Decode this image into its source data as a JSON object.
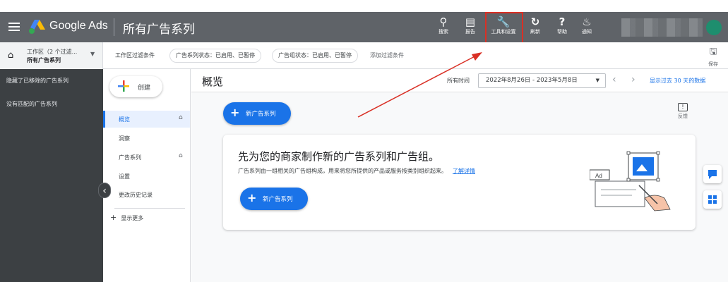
{
  "header": {
    "brand": "Google Ads",
    "page_title": "所有广告系列",
    "tools": [
      {
        "icon": "search-icon",
        "label": "搜索"
      },
      {
        "icon": "reports-icon",
        "label": "报告"
      },
      {
        "icon": "wrench-icon",
        "label": "工具和设置"
      },
      {
        "icon": "refresh-icon",
        "label": "刷新"
      },
      {
        "icon": "help-icon",
        "label": "帮助"
      },
      {
        "icon": "bell-icon",
        "label": "通知"
      }
    ]
  },
  "workspace": {
    "line1": "工作区（2 个过滤...",
    "line2": "所有广告系列"
  },
  "filterbar": {
    "label": "工作区过滤条件",
    "chips": [
      "广告系列状态：已启用、已暂停",
      "广告组状态：已启用、已暂停"
    ],
    "add_filter": "添加过滤条件",
    "save_label": "保存"
  },
  "left_panel": {
    "removed": "隐藏了已移除的广告系列",
    "none": "没有匹配的广告系列"
  },
  "nav": {
    "create_label": "创建",
    "items": [
      {
        "label": "概览",
        "active": true
      },
      {
        "label": "洞察"
      },
      {
        "label": "广告系列"
      },
      {
        "label": "设置"
      },
      {
        "label": "更改历史记录"
      }
    ],
    "show_more": "显示更多"
  },
  "main": {
    "title": "概览",
    "date_label": "所有时间",
    "date_range": "2022年8月26日 - 2023年5月8日",
    "last30": "显示过去 30 天的数据",
    "new_campaign_label": "新广告系列",
    "feedback_label": "反馈",
    "card": {
      "title": "先为您的商家制作新的广告系列和广告组。",
      "desc": "广告系列由一组相关的广告组构成，用来将您所提供的产品或服务按类别组织起来。",
      "link": "了解详情",
      "button_label": "新广告系列",
      "illus_ad": "Ad"
    }
  },
  "colors": {
    "topbar": "#5f6368",
    "accent": "#1a73e8",
    "annotation": "#d93025",
    "left_panel": "#3c4043"
  }
}
